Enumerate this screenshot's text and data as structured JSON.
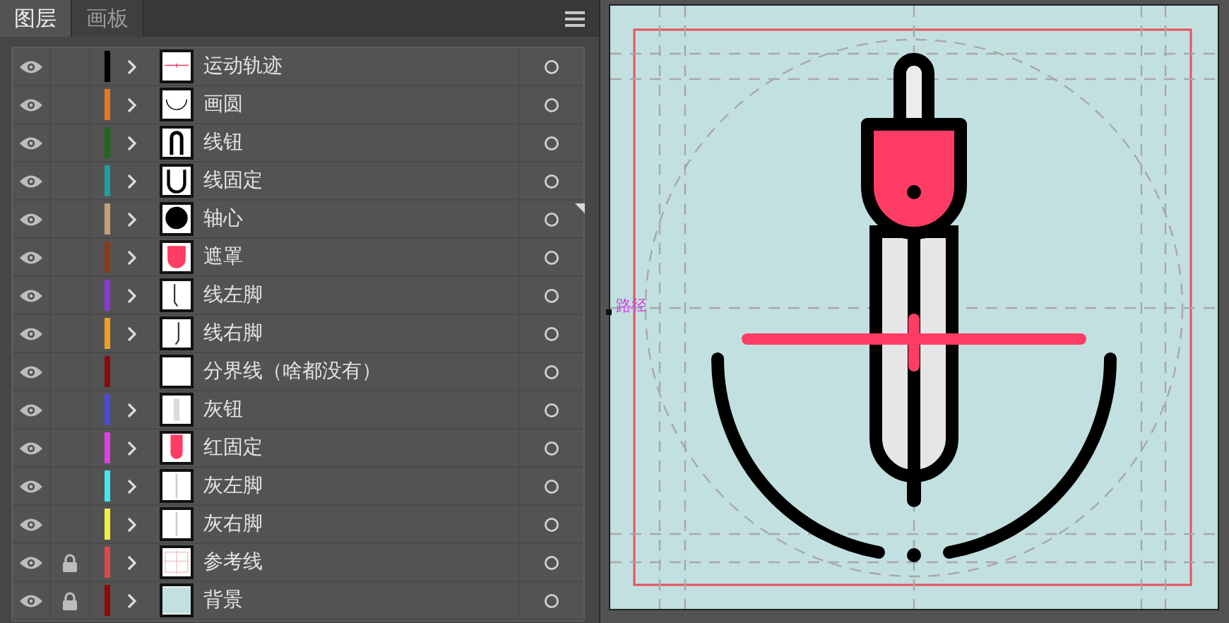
{
  "panel": {
    "tabs": [
      {
        "label": "图层",
        "selected": true
      },
      {
        "label": "画板",
        "selected": false
      }
    ],
    "layers": [
      {
        "name": "运动轨迹",
        "color": "#000000",
        "visible": true,
        "locked": false,
        "expandable": true,
        "kind": "cross"
      },
      {
        "name": "画圆",
        "color": "#e87722",
        "visible": true,
        "locked": false,
        "expandable": true,
        "kind": "arc"
      },
      {
        "name": "线钮",
        "color": "#1a6b1a",
        "visible": true,
        "locked": false,
        "expandable": true,
        "kind": "loop"
      },
      {
        "name": "线固定",
        "color": "#1aa0a0",
        "visible": true,
        "locked": false,
        "expandable": true,
        "kind": "cup"
      },
      {
        "name": "轴心",
        "color": "#c8a078",
        "visible": true,
        "locked": false,
        "expandable": true,
        "kind": "dot"
      },
      {
        "name": "遮罩",
        "color": "#8b3a14",
        "visible": true,
        "locked": false,
        "expandable": true,
        "kind": "redcup"
      },
      {
        "name": "线左脚",
        "color": "#8a3ad8",
        "visible": true,
        "locked": false,
        "expandable": true,
        "kind": "leftleg"
      },
      {
        "name": "线右脚",
        "color": "#f0a020",
        "visible": true,
        "locked": false,
        "expandable": true,
        "kind": "rightleg"
      },
      {
        "name": "分界线（啥都没有）",
        "color": "#8b0a0a",
        "visible": true,
        "locked": false,
        "expandable": false,
        "kind": "blank"
      },
      {
        "name": "灰钮",
        "color": "#4a4ae0",
        "visible": true,
        "locked": false,
        "expandable": true,
        "kind": "greybar"
      },
      {
        "name": "红固定",
        "color": "#e040e0",
        "visible": true,
        "locked": false,
        "expandable": true,
        "kind": "redhead"
      },
      {
        "name": "灰左脚",
        "color": "#40e8f0",
        "visible": true,
        "locked": false,
        "expandable": true,
        "kind": "greyline"
      },
      {
        "name": "灰右脚",
        "color": "#f0f040",
        "visible": true,
        "locked": false,
        "expandable": true,
        "kind": "greyline"
      },
      {
        "name": "参考线",
        "color": "#e04848",
        "visible": true,
        "locked": true,
        "expandable": true,
        "kind": "grid"
      },
      {
        "name": "背景",
        "color": "#900a0a",
        "visible": true,
        "locked": true,
        "expandable": true,
        "kind": "fill"
      }
    ]
  },
  "canvas": {
    "path_label": "路径"
  }
}
